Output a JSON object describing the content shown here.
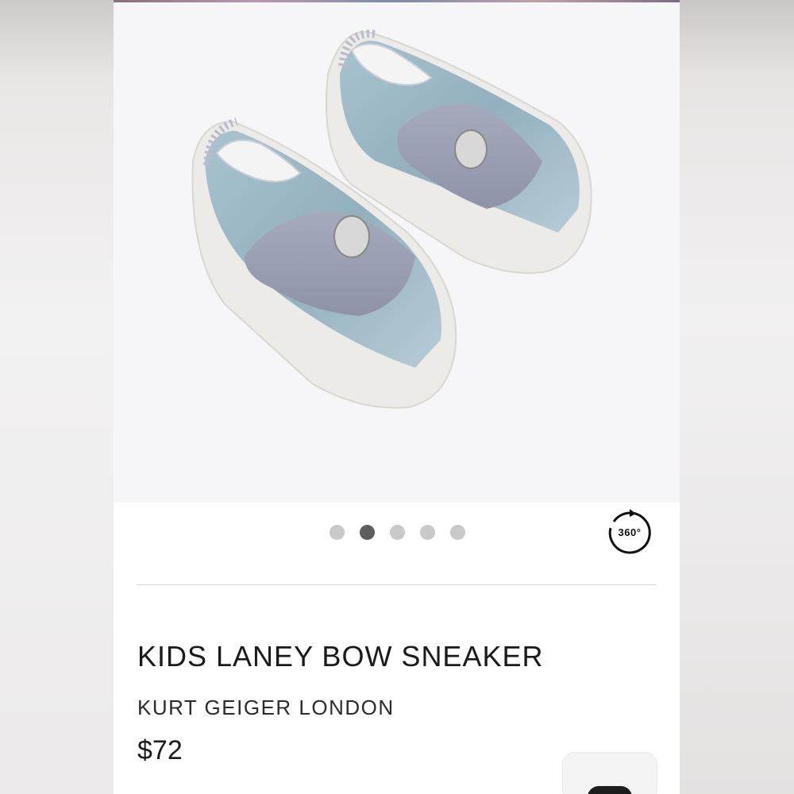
{
  "product": {
    "title": "KIDS LANEY BOW SNEAKER",
    "brand": "KURT GEIGER LONDON",
    "price": "$72"
  },
  "carousel": {
    "dots": 5,
    "active_index": 1,
    "view360_label": "360°"
  },
  "image": {
    "alt": "Kids Laney Bow Sneaker - light blue denim slip-on sneakers with crystal bow",
    "shoe_color": "#9fb8c4",
    "bow_color": "#9a9fb3"
  },
  "cart": {
    "icon": "bag-icon"
  }
}
